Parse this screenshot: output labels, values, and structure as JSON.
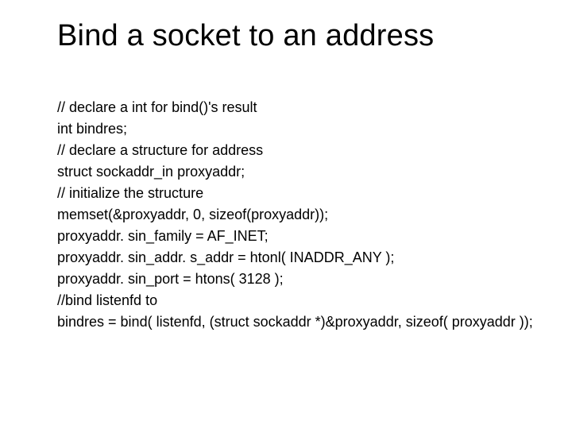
{
  "title": "Bind a socket to an address",
  "code": {
    "l1": "// declare a int for bind()'s result",
    "l2": "int bindres;",
    "l3": "// declare a structure for address",
    "l4": "struct sockaddr_in proxyaddr;",
    "l5": "// initialize the structure",
    "l6": "memset(&proxyaddr, 0, sizeof(proxyaddr));",
    "l7": "proxyaddr. sin_family = AF_INET;",
    "l8": "proxyaddr. sin_addr. s_addr = htonl( INADDR_ANY );",
    "l9": "proxyaddr. sin_port = htons( 3128 );",
    "l10": "//bind listenfd to",
    "l11": "bindres = bind( listenfd, (struct sockaddr *)&proxyaddr, sizeof( proxyaddr ));"
  }
}
